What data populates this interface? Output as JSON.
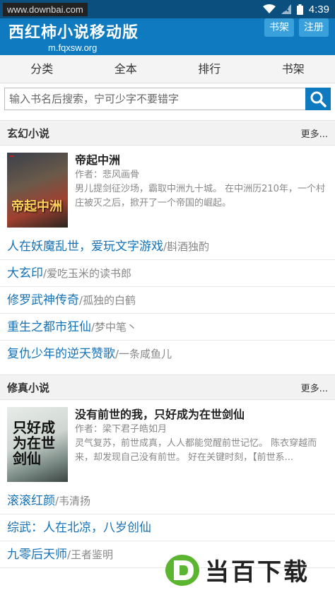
{
  "statusbar": {
    "site": "www.downbai.com",
    "time": "4:39"
  },
  "header": {
    "brand": "西红柿小说移动版",
    "domain": "m.fqxsw.org",
    "shelf_button": "书架",
    "register_button": "注册"
  },
  "nav": [
    "分类",
    "全本",
    "排行",
    "书架"
  ],
  "search": {
    "placeholder": "输入书名后搜索，宁可少字不要错字"
  },
  "sections": [
    {
      "title": "玄幻小说",
      "more": "更多...",
      "featured": {
        "title": "帝起中洲",
        "author": "作者：悲风画骨",
        "desc": "男儿提剑征沙场，霸取中洲九十城。 在中洲历210年，一个村庄被灭之后，掀开了一个帝国的崛起。",
        "cover_text": "帝起中洲"
      },
      "items": [
        {
          "title": "人在妖魔乱世，爱玩文字游戏",
          "author": "/斟酒独酌"
        },
        {
          "title": "大玄印",
          "author": "/爱吃玉米的读书郎"
        },
        {
          "title": "修罗武神传奇",
          "author": "/孤独的白鹤"
        },
        {
          "title": "重生之都市狂仙",
          "author": "/梦中笔丶"
        },
        {
          "title": "复仇少年的逆天赞歌",
          "author": "/一条咸鱼儿"
        }
      ]
    },
    {
      "title": "修真小说",
      "more": "更多...",
      "featured": {
        "title": "没有前世的我，只好成为在世剑仙",
        "author": "作者：梁下君子皓如月",
        "desc": "灵气复苏，前世成真，人人都能觉醒前世记忆。 陈衣穿越而来，却发现自己没有前世。 好在关键时刻，【前世系...",
        "cover_text": "只好成为在世剑仙"
      },
      "items": [
        {
          "title": "滚滚红颜",
          "author": "/韦清扬"
        },
        {
          "title": "综武：人在北凉，八岁创仙",
          "author": ""
        },
        {
          "title": "九零后天师",
          "author": "/王者鉴明"
        }
      ]
    }
  ],
  "watermark": {
    "logo_text": "当百下载"
  },
  "colors": {
    "header": "#0f7ac0",
    "statusbar": "#0a4f7e",
    "link": "#1472b8"
  }
}
